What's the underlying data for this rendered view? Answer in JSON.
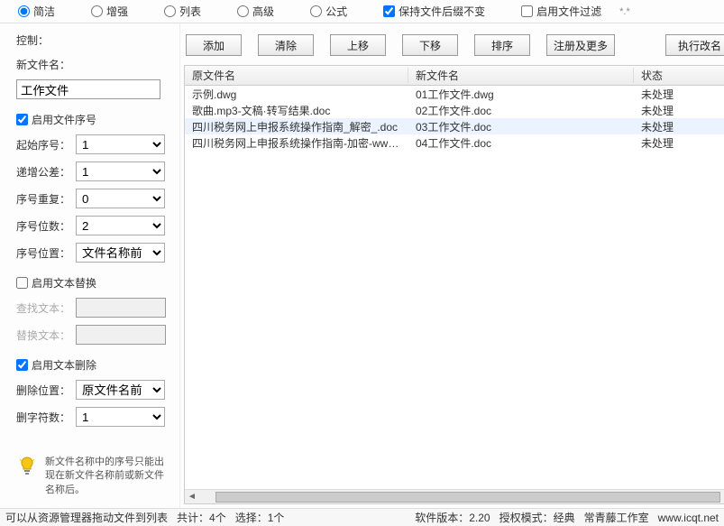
{
  "top_tabs": {
    "simple": "简洁",
    "enhanced": "增强",
    "list": "列表",
    "advanced": "高级",
    "formula": "公式"
  },
  "top_options": {
    "keep_ext": "保持文件后缀不变",
    "enable_filter": "启用文件过滤",
    "filter_pattern": "*.*"
  },
  "left": {
    "control_label": "控制：",
    "new_name_label": "新文件名：",
    "new_name_value": "工作文件",
    "enable_seq": "启用文件序号",
    "start_seq_label": "起始序号：",
    "start_seq": "1",
    "step_label": "递增公差：",
    "step": "1",
    "repeat_label": "序号重复：",
    "repeat": "0",
    "digits_label": "序号位数：",
    "digits": "2",
    "pos_label": "序号位置：",
    "pos": "文件名称前",
    "enable_replace": "启用文本替换",
    "find_label": "查找文本：",
    "replace_label": "替换文本：",
    "enable_delete": "启用文本删除",
    "del_pos_label": "删除位置：",
    "del_pos": "原文件名前",
    "del_chars_label": "删字符数：",
    "del_chars": "1",
    "hint": "新文件名称中的序号只能出现在新文件名称前或新文件名称后。"
  },
  "toolbar": {
    "add": "添加",
    "clear": "清除",
    "up": "上移",
    "down": "下移",
    "sort": "排序",
    "more": "注册及更多",
    "exec": "执行改名"
  },
  "table": {
    "headers": {
      "orig": "原文件名",
      "newn": "新文件名",
      "status": "状态"
    },
    "rows": [
      {
        "orig": "示例.dwg",
        "newn": "01工作文件.dwg",
        "status": "未处理"
      },
      {
        "orig": "歌曲.mp3-文稿·转写结果.doc",
        "newn": "02工作文件.doc",
        "status": "未处理"
      },
      {
        "orig": "四川税务网上申报系统操作指南_解密_.doc",
        "newn": "03工作文件.doc",
        "status": "未处理"
      },
      {
        "orig": "四川税务网上申报系统操作指南-加密-www...",
        "newn": "04工作文件.doc",
        "status": "未处理"
      }
    ]
  },
  "status": {
    "drag_hint": "可以从资源管理器拖动文件到列表",
    "total": "共计：4个",
    "select": "选择：1个",
    "version": "软件版本：2.20",
    "license": "授权模式：经典",
    "studio": "常青藤工作室",
    "url": "www.icqt.net"
  }
}
